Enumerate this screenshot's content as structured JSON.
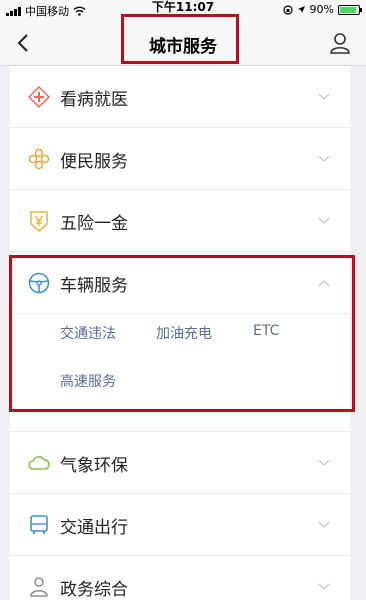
{
  "status_bar": {
    "carrier": "中国移动",
    "time": "下午11:07",
    "battery": "90%",
    "battery_level": 0.9
  },
  "nav": {
    "title": "城市服务"
  },
  "services": [
    {
      "label": "看病就医",
      "icon": "medical-cross-icon"
    },
    {
      "label": "便民服务",
      "icon": "flower-icon"
    },
    {
      "label": "五险一金",
      "icon": "yen-shield-icon"
    },
    {
      "label": "车辆服务",
      "icon": "steering-wheel-icon",
      "expanded": true,
      "sub_items": [
        "交通违法",
        "加油充电",
        "ETC",
        "高速服务"
      ]
    },
    {
      "label": "气象环保",
      "icon": "cloud-icon"
    },
    {
      "label": "交通出行",
      "icon": "bus-icon"
    },
    {
      "label": "政务综合",
      "icon": "person-icon"
    }
  ],
  "colors": {
    "highlight": "#b0121c",
    "sub_item_text": "#5a6e8f"
  }
}
